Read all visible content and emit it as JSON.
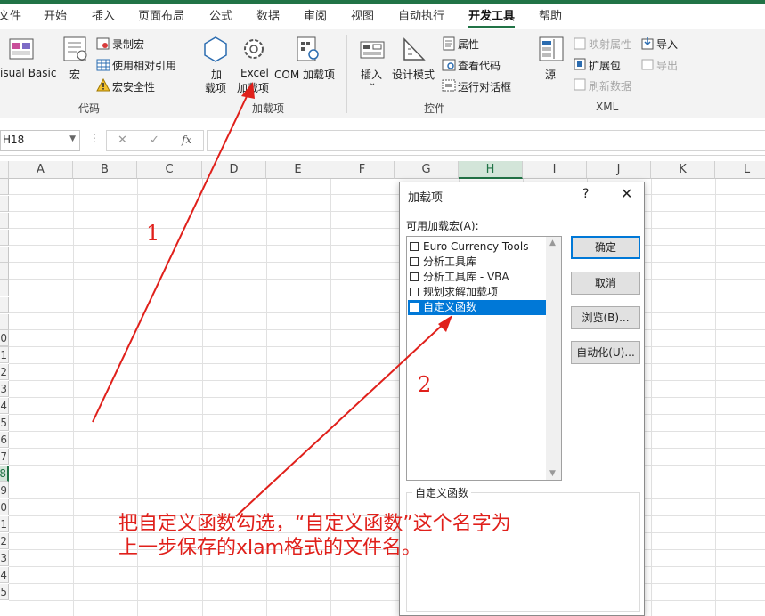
{
  "tabs": [
    "文件",
    "开始",
    "插入",
    "页面布局",
    "公式",
    "数据",
    "审阅",
    "视图",
    "自动执行",
    "开发工具",
    "帮助"
  ],
  "active_tab": "开发工具",
  "ribbon": {
    "code": {
      "visual_basic": "isual Basic",
      "macro": "宏",
      "record_macro": "录制宏",
      "relative_ref": "使用相对引用",
      "macro_security": "宏安全性",
      "group": "代码"
    },
    "addins": {
      "addin_1": "加",
      "addin_2": "载项",
      "excel_1": "Excel",
      "excel_2": "加载项",
      "com": "COM 加载项",
      "group": "加载项"
    },
    "controls": {
      "insert": "插入",
      "design_mode": "设计模式",
      "properties": "属性",
      "view_code": "查看代码",
      "run_dialog": "运行对话框",
      "group": "控件"
    },
    "xml": {
      "source": "源",
      "map_properties": "映射属性",
      "expansion_packs": "扩展包",
      "refresh_data": "刷新数据",
      "import": "导入",
      "export": "导出",
      "group": "XML"
    }
  },
  "formula_bar": {
    "name_box": "H18",
    "cancel": "✕",
    "enter": "✓",
    "fx": "fx"
  },
  "columns": [
    "A",
    "B",
    "C",
    "D",
    "E",
    "F",
    "G",
    "H",
    "I",
    "J",
    "K",
    "L"
  ],
  "selected_column": "H",
  "rows": [
    "",
    "",
    "",
    "",
    "",
    "",
    "",
    "",
    "",
    "",
    "0",
    "1",
    "2",
    "3",
    "4",
    "5",
    "6",
    "7",
    "8",
    "9",
    "0",
    "1",
    "2",
    "3",
    "4",
    "5"
  ],
  "dialog": {
    "title": "加载项",
    "help": "?",
    "close": "✕",
    "list_label": "可用加载宏(A):",
    "items": [
      {
        "label": "Euro Currency Tools",
        "checked": false
      },
      {
        "label": "分析工具库",
        "checked": false
      },
      {
        "label": "分析工具库 - VBA",
        "checked": false
      },
      {
        "label": "规划求解加载项",
        "checked": false
      },
      {
        "label": "自定义函数",
        "checked": true
      }
    ],
    "ok": "确定",
    "cancel": "取消",
    "browse": "浏览(B)...",
    "automation": "自动化(U)...",
    "description_title": "自定义函数"
  },
  "annotations": {
    "one": "1",
    "two": "2",
    "line1": "把自定义函数勾选，“自定义函数”这个名字为",
    "line2": "上一步保存的xlam格式的文件名。",
    "color": "#e0201b"
  }
}
